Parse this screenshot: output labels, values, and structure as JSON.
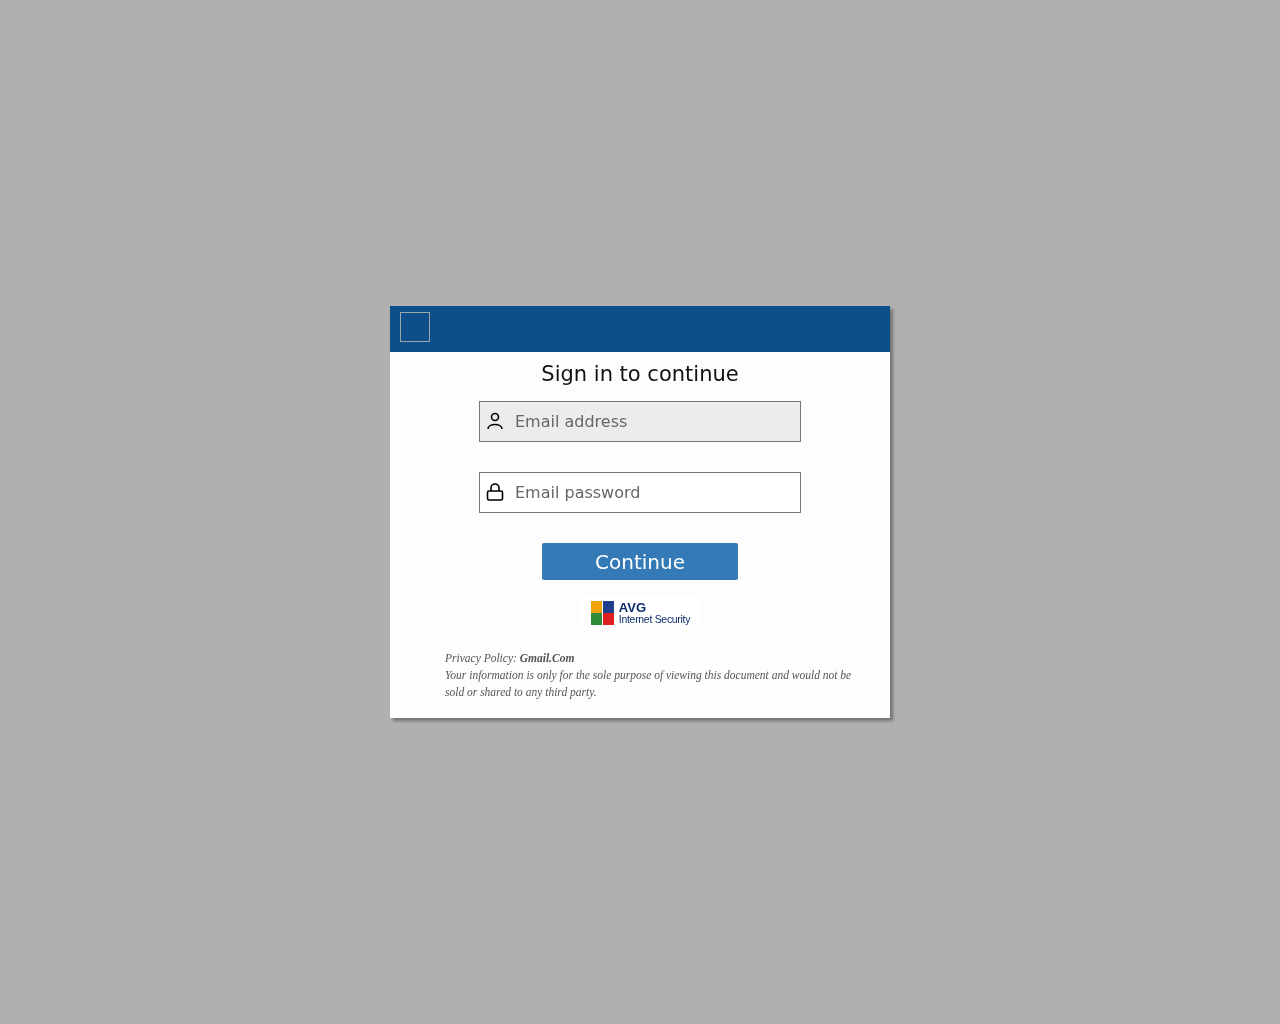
{
  "dialog": {
    "title": "Sign in to continue",
    "fields": [
      {
        "kind": "user",
        "placeholder": "Email address",
        "focused": true
      },
      {
        "kind": "lock",
        "placeholder": "Email password",
        "focused": false
      }
    ],
    "button": "Continue",
    "badge": {
      "brand": "AVG",
      "product": "Internet Security"
    },
    "privacy": "Privacy Policy: **Gmail.Com**",
    "note": "Your information is only for the sole purpose of viewing this document and would not be sold or shared to any third party."
  }
}
